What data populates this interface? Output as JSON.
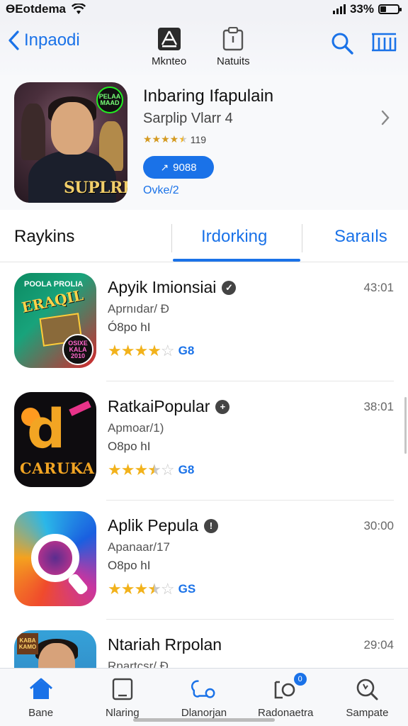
{
  "status_bar": {
    "carrier": "ӨEotdema",
    "battery": "33%",
    "battery_level": 0.33
  },
  "header": {
    "back_label": "Inpaodi",
    "tabs": [
      {
        "label": "Mknteo",
        "icon": "a-logo-icon"
      },
      {
        "label": "Natuits",
        "icon": "clipboard-icon"
      }
    ],
    "right_icons": [
      "search-icon",
      "list-icon"
    ]
  },
  "featured": {
    "title": "Inbaring Ifapulain",
    "subtitle": "Sarplip Vlarr 4",
    "rating_text": "119",
    "rating_stars": 4.5,
    "button_label": "9088",
    "note": "Ovke/2",
    "art_badge": "PELAA MAAD",
    "art_logo": "SUPLRE"
  },
  "segments": {
    "left": "Raykins",
    "tabs": [
      "Irdorking",
      "Saraıls"
    ],
    "active": "Irdorking"
  },
  "apps": [
    {
      "title": "Apyik Imionsiai",
      "line1": "Aprnıdar/ Ð",
      "line2": "Ó8po hI",
      "rating": 4.0,
      "count": "G8",
      "time": "43:01",
      "icon": "comic-poster-icon",
      "art_text": "POOLA PROLIA",
      "art_badge": "OSIXE KALA 2010"
    },
    {
      "title": "RatkaiPopular",
      "line1": "Apmoar/1)",
      "line2": "O8po hI",
      "rating": 3.5,
      "count": "G8",
      "time": "38:01",
      "icon": "music-note-icon",
      "art_text": "CARUKA"
    },
    {
      "title": "Aplik Pepula",
      "line1": "Apanaar/17",
      "line2": "O8po hI",
      "rating": 3.5,
      "count": "GS",
      "time": "30:00",
      "icon": "magnifier-ring-icon"
    },
    {
      "title": "Ntariah Rrpolan",
      "line1": "Rpartcsr/ Ð",
      "line2": "",
      "rating": 0,
      "count": "",
      "time": "29:04",
      "icon": "portrait-icon",
      "art_text": "KABA KAMO"
    }
  ],
  "tabbar": [
    {
      "label": "Bane",
      "icon": "home-icon",
      "active": true
    },
    {
      "label": "Nlaring",
      "icon": "tablet-icon"
    },
    {
      "label": "Dlanorjan",
      "icon": "gamepad-icon"
    },
    {
      "label": "Radonaetra",
      "icon": "folder-icon",
      "badge": "0"
    },
    {
      "label": "Sampate",
      "icon": "search-icon"
    }
  ],
  "colors": {
    "accent": "#1a72e8",
    "star": "#f2b21b",
    "background": "#ffffff"
  }
}
